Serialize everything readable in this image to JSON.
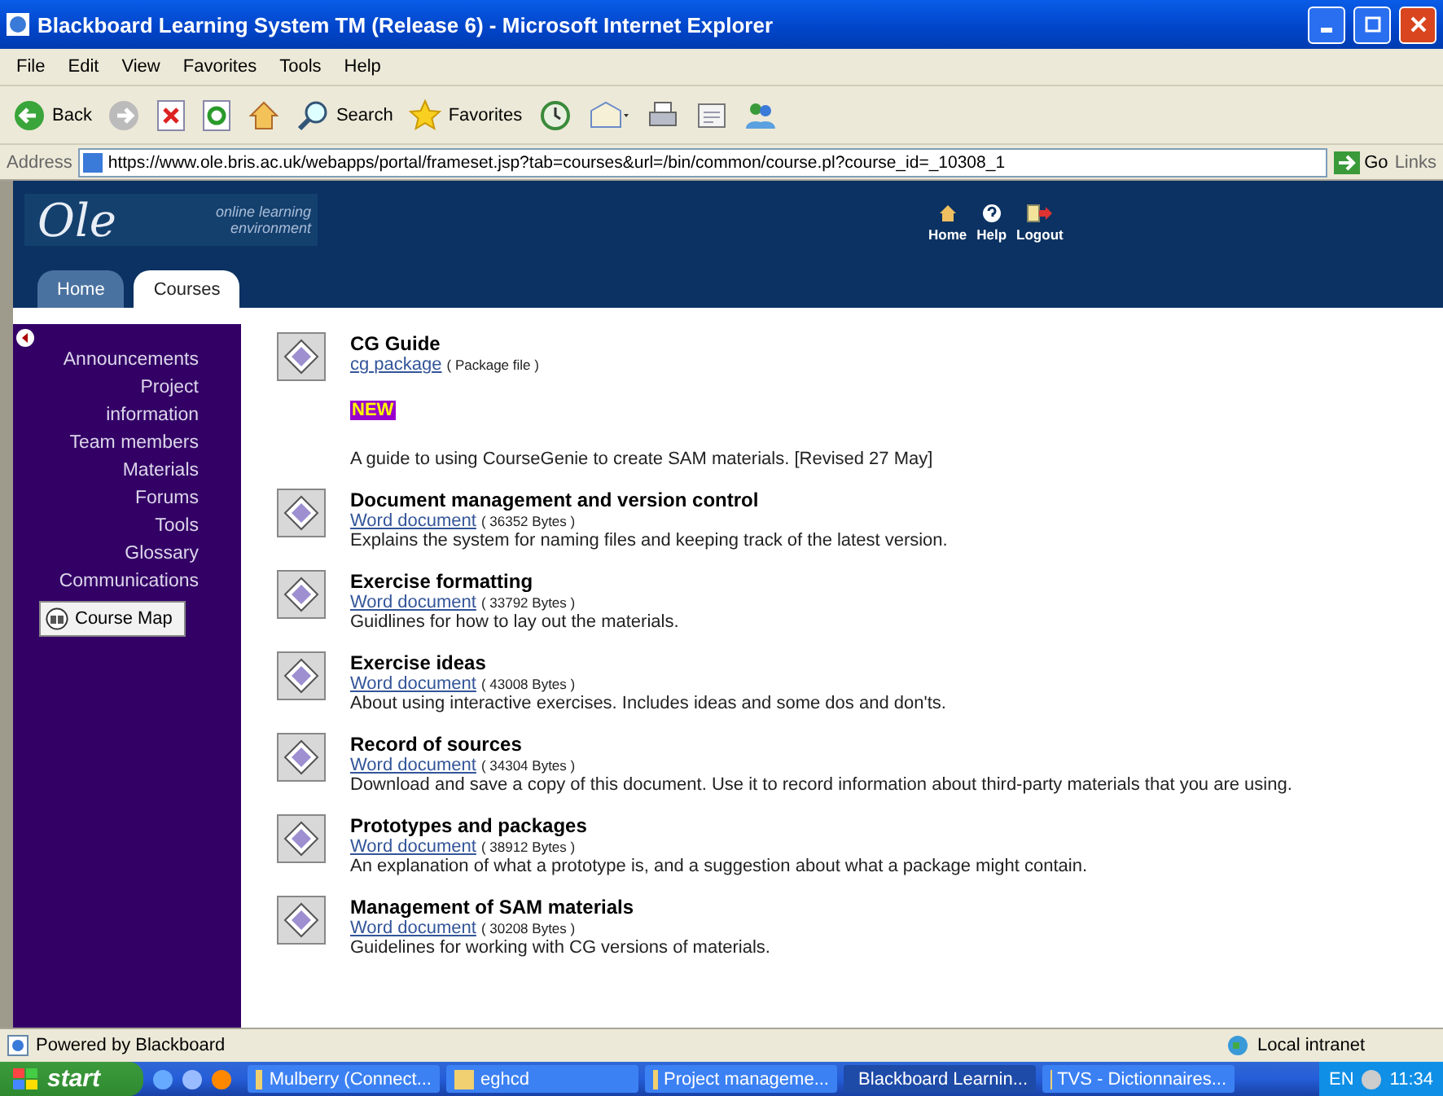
{
  "window": {
    "title": "Blackboard Learning System TM (Release 6) - Microsoft Internet Explorer"
  },
  "menu": [
    "File",
    "Edit",
    "View",
    "Favorites",
    "Tools",
    "Help"
  ],
  "toolbar": [
    {
      "kind": "back",
      "label": "Back"
    },
    {
      "kind": "forward"
    },
    {
      "kind": "stop"
    },
    {
      "kind": "refresh"
    },
    {
      "kind": "home"
    },
    {
      "kind": "search",
      "label": "Search"
    },
    {
      "kind": "favorites",
      "label": "Favorites"
    },
    {
      "kind": "history"
    },
    {
      "kind": "mail"
    },
    {
      "kind": "print"
    },
    {
      "kind": "edit"
    },
    {
      "kind": "messenger"
    }
  ],
  "address_bar": {
    "label": "Address",
    "value": "https://www.ole.bris.ac.uk/webapps/portal/frameset.jsp?tab=courses&url=/bin/common/course.pl?course_id=_10308_1",
    "go": "Go",
    "links": "Links"
  },
  "header": {
    "logo": "Ole",
    "tagline": [
      "online learning",
      "environment"
    ],
    "nav": [
      {
        "kind": "home",
        "label": "Home"
      },
      {
        "kind": "help",
        "label": "Help"
      },
      {
        "kind": "logout",
        "label": "Logout"
      }
    ],
    "tabs": [
      {
        "label": "Home",
        "selected": false
      },
      {
        "label": "Courses",
        "selected": true
      }
    ]
  },
  "sidebar": {
    "items": [
      "Announcements",
      "Project information",
      "Team members",
      "Materials",
      "Forums",
      "Tools",
      "Glossary",
      "Communications"
    ],
    "course_map": "Course Map"
  },
  "entries": [
    {
      "title": "CG Guide",
      "link": "cg package",
      "file_info": "( Package file )",
      "badge": "NEW",
      "description": "A guide to using CourseGenie to create SAM materials. [Revised 27 May]"
    },
    {
      "title": "Document management and version control",
      "link": "Word document",
      "file_info": "( 36352 Bytes )",
      "description": "Explains the system for naming files and keeping track of the latest version."
    },
    {
      "title": "Exercise formatting",
      "link": "Word document",
      "file_info": "( 33792 Bytes )",
      "description": "Guidlines for how to lay out the materials."
    },
    {
      "title": "Exercise ideas",
      "link": "Word document",
      "file_info": "( 43008 Bytes )",
      "description": "About using interactive exercises. Includes ideas and some dos and don'ts."
    },
    {
      "title": "Record of sources",
      "link": "Word document",
      "file_info": "( 34304 Bytes )",
      "description": "Download and save a copy of this document. Use it to record information about third-party materials that you are using."
    },
    {
      "title": "Prototypes and packages",
      "link": "Word document",
      "file_info": "( 38912 Bytes )",
      "description": "An explanation of what a prototype is, and a suggestion about what a package might contain."
    },
    {
      "title": "Management of SAM materials",
      "link": "Word document",
      "file_info": "( 30208 Bytes )",
      "description": "Guidelines for working with CG versions of materials."
    }
  ],
  "status_bar": {
    "left": "Powered by Blackboard",
    "right": "Local intranet"
  },
  "taskbar": {
    "start": "start",
    "tasks": [
      {
        "label": "Mulberry (Connect...",
        "selected": false
      },
      {
        "label": "eghcd",
        "selected": false
      },
      {
        "label": "Project manageme...",
        "selected": false
      },
      {
        "label": "Blackboard Learnin...",
        "selected": true
      },
      {
        "label": "TVS - Dictionnaires...",
        "selected": false
      }
    ],
    "language": "EN",
    "clock": "11:34"
  }
}
